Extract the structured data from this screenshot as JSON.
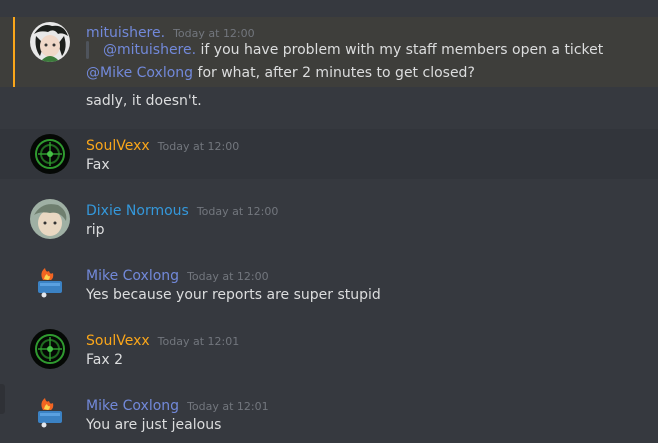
{
  "messages": [
    {
      "author": "mituishere.",
      "author_color": "#7289da",
      "time": "Today at 12:00",
      "quote_mention": "@mituishere.",
      "quote_text": " if you have problem with my staff members open a ticket",
      "reply_mention": "@Mike Coxlong",
      "reply_text": " for what, after 2 minutes to get closed?",
      "extra": "sadly, it doesn't."
    },
    {
      "author": "SoulVexx",
      "author_color": "#faa61a",
      "time": "Today at 12:00",
      "text": "Fax"
    },
    {
      "author": "Dixie Normous",
      "author_color": "#3498db",
      "time": "Today at 12:00",
      "text": "rip"
    },
    {
      "author": "Mike Coxlong",
      "author_color": "#7289da",
      "time": "Today at 12:00",
      "text": "Yes because your reports are super stupid"
    },
    {
      "author": "SoulVexx",
      "author_color": "#faa61a",
      "time": "Today at 12:01",
      "text": "Fax 2"
    },
    {
      "author": "Mike Coxlong",
      "author_color": "#7289da",
      "time": "Today at 12:01",
      "text": "You are just jealous"
    }
  ]
}
